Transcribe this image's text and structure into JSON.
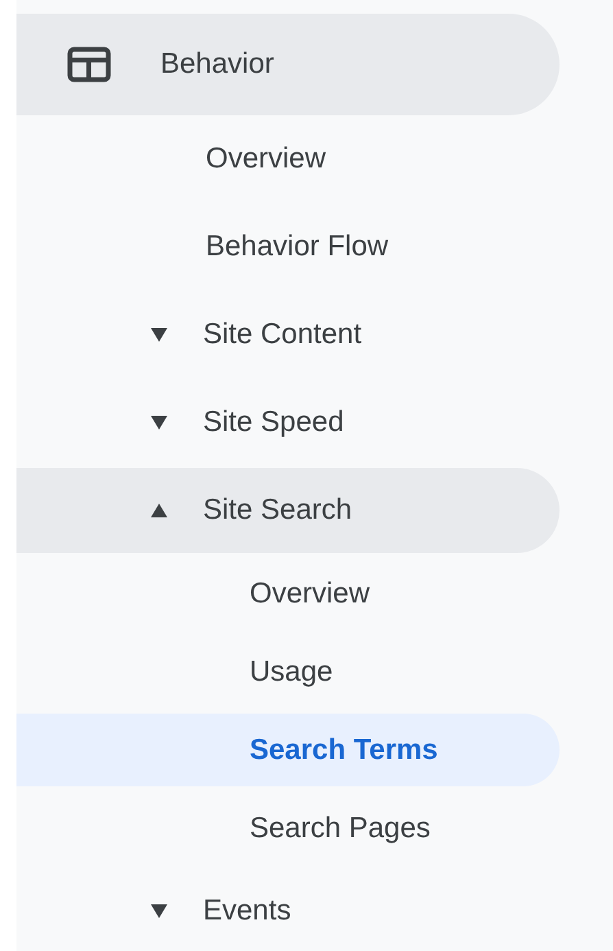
{
  "sidebar": {
    "items": [
      {
        "kind": "section",
        "label": "Behavior",
        "highlighted": true,
        "selected": false,
        "children": [
          {
            "kind": "link",
            "label": "Overview",
            "highlighted": false,
            "selected": false
          },
          {
            "kind": "link",
            "label": "Behavior Flow",
            "highlighted": false,
            "selected": false
          },
          {
            "kind": "group",
            "label": "Site Content",
            "expanded": false,
            "highlighted": false,
            "selected": false
          },
          {
            "kind": "group",
            "label": "Site Speed",
            "expanded": false,
            "highlighted": false,
            "selected": false
          },
          {
            "kind": "group",
            "label": "Site Search",
            "expanded": true,
            "highlighted": true,
            "selected": false,
            "children": [
              {
                "kind": "link",
                "label": "Overview",
                "highlighted": false,
                "selected": false
              },
              {
                "kind": "link",
                "label": "Usage",
                "highlighted": false,
                "selected": false
              },
              {
                "kind": "link",
                "label": "Search Terms",
                "highlighted": false,
                "selected": true
              },
              {
                "kind": "link",
                "label": "Search Pages",
                "highlighted": false,
                "selected": false
              }
            ]
          },
          {
            "kind": "group",
            "label": "Events",
            "expanded": false,
            "highlighted": false,
            "selected": false
          }
        ]
      }
    ]
  }
}
